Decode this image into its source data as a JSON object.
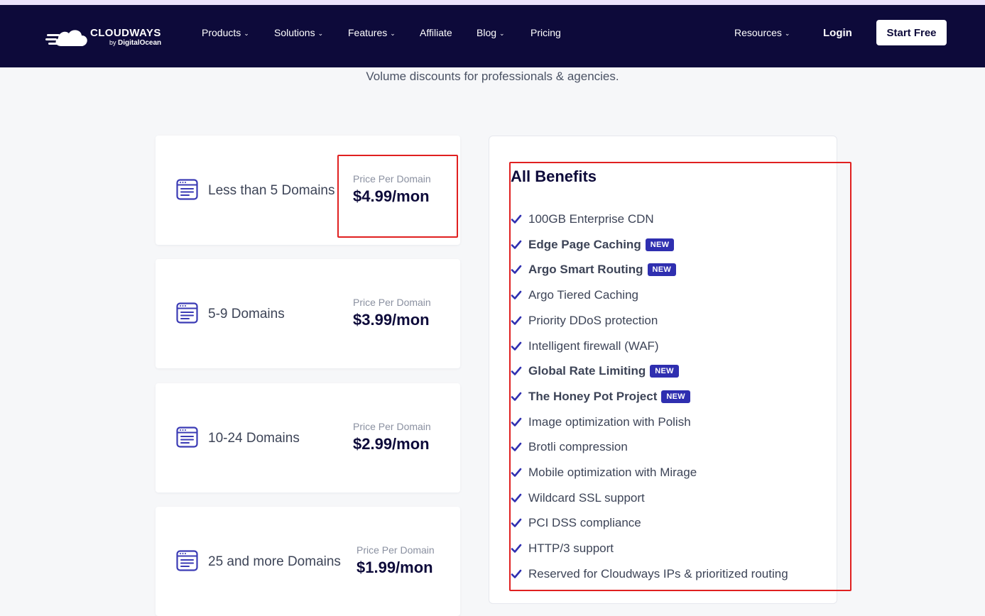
{
  "brand": {
    "name": "CLOUDWAYS",
    "by": "by",
    "owner": "DigitalOcean"
  },
  "nav": {
    "items": [
      {
        "label": "Products",
        "dropdown": true
      },
      {
        "label": "Solutions",
        "dropdown": true
      },
      {
        "label": "Features",
        "dropdown": true
      },
      {
        "label": "Affiliate",
        "dropdown": false
      },
      {
        "label": "Blog",
        "dropdown": true
      },
      {
        "label": "Pricing",
        "dropdown": false
      }
    ],
    "resources": {
      "label": "Resources",
      "dropdown": true
    },
    "login": "Login",
    "start": "Start Free"
  },
  "subtitle": "Volume discounts for professionals & agencies.",
  "tiers": [
    {
      "label": "Less than 5 Domains",
      "price_label": "Price Per Domain",
      "price": "$4.99/mon"
    },
    {
      "label": "5-9 Domains",
      "price_label": "Price Per Domain",
      "price": "$3.99/mon"
    },
    {
      "label": "10-24 Domains",
      "price_label": "Price Per Domain",
      "price": "$2.99/mon"
    },
    {
      "label": "25 and more Domains",
      "price_label": "Price Per Domain",
      "price": "$1.99/mon"
    }
  ],
  "benefits": {
    "title": "All Benefits",
    "new_badge": "NEW",
    "items": [
      {
        "text": "100GB Enterprise CDN",
        "is_new": false
      },
      {
        "text": "Edge Page Caching",
        "is_new": true
      },
      {
        "text": "Argo Smart Routing",
        "is_new": true
      },
      {
        "text": "Argo Tiered Caching",
        "is_new": false
      },
      {
        "text": "Priority DDoS protection",
        "is_new": false
      },
      {
        "text": "Intelligent firewall (WAF)",
        "is_new": false
      },
      {
        "text": "Global Rate Limiting",
        "is_new": true
      },
      {
        "text": "The Honey Pot Project",
        "is_new": true
      },
      {
        "text": "Image optimization with Polish",
        "is_new": false
      },
      {
        "text": "Brotli compression",
        "is_new": false
      },
      {
        "text": "Mobile optimization with Mirage",
        "is_new": false
      },
      {
        "text": "Wildcard SSL support",
        "is_new": false
      },
      {
        "text": "PCI DSS compliance",
        "is_new": false
      },
      {
        "text": "HTTP/3 support",
        "is_new": false
      },
      {
        "text": "Reserved for Cloudways IPs & prioritized routing",
        "is_new": false
      }
    ]
  },
  "colors": {
    "navbar": "#0d0a3a",
    "accent": "#2f2fb0",
    "highlight": "#e02020",
    "page_bg": "#f6f7f9"
  }
}
